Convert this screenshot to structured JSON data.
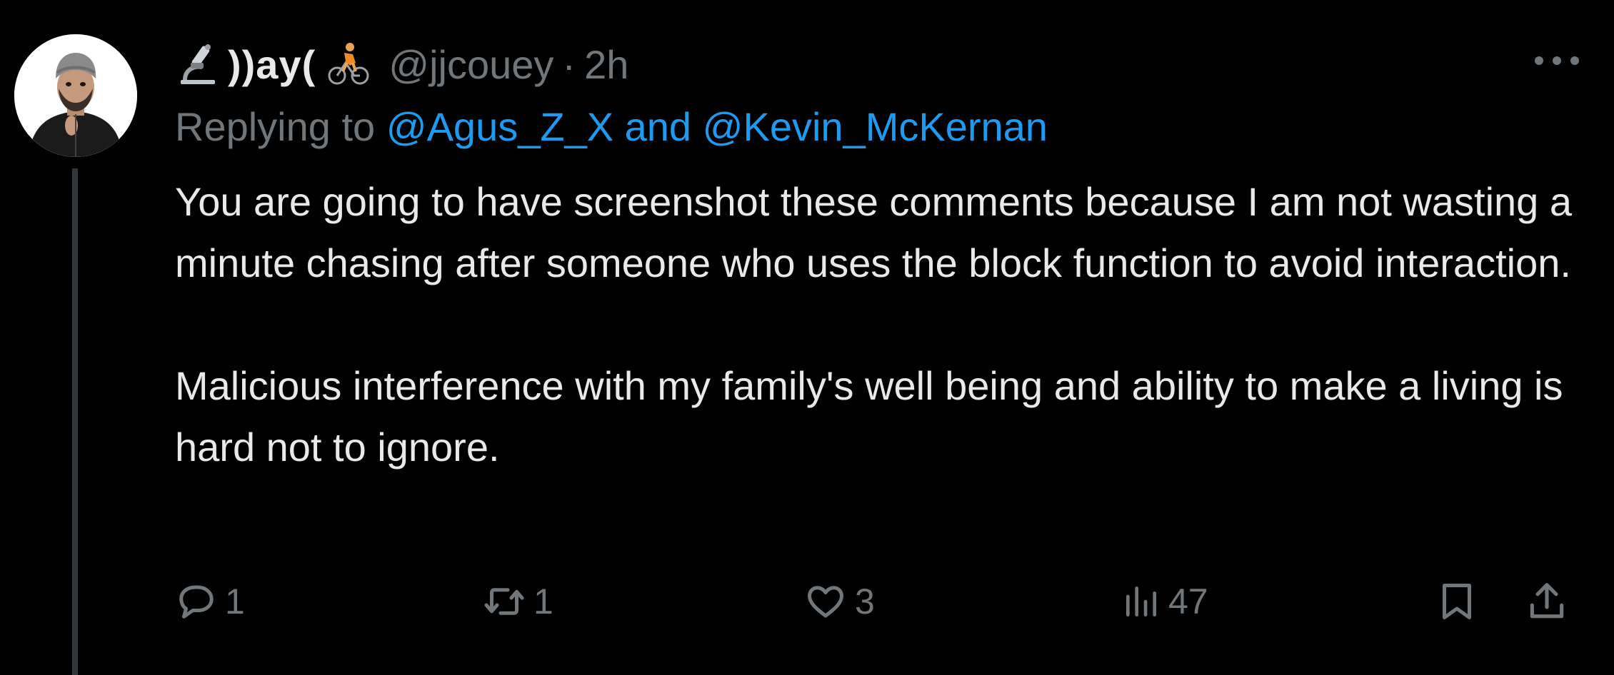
{
  "colors": {
    "background": "#000000",
    "text_primary": "#e7e9ea",
    "text_secondary": "#71767b",
    "mention": "#1d9bf0",
    "thread_line": "#333639"
  },
  "author": {
    "name_icon_left": "microscope-emoji",
    "display_name": "))ay(",
    "name_icon_right": "cyclist-emoji",
    "handle": "@jjcouey",
    "separator": "·",
    "time": "2h"
  },
  "reply": {
    "prefix": "Replying to",
    "mention_1": "@Agus_Z_X",
    "conjunction": "and",
    "mention_2": "@Kevin_McKernan"
  },
  "body": {
    "paragraph_1": "You are going to have screenshot these comments because I am not wasting a minute chasing after someone who uses the block function to avoid interaction.",
    "paragraph_2": "Malicious interference with my family's well being and ability to make a living is hard not to ignore."
  },
  "actions": {
    "replies": "1",
    "reposts": "1",
    "likes": "3",
    "views": "47"
  },
  "icons": {
    "more": "more-horizontal-icon",
    "reply": "reply-bubble-icon",
    "repost": "repost-icon",
    "like": "heart-icon",
    "views": "views-chart-icon",
    "bookmark": "bookmark-icon",
    "share": "share-icon"
  }
}
